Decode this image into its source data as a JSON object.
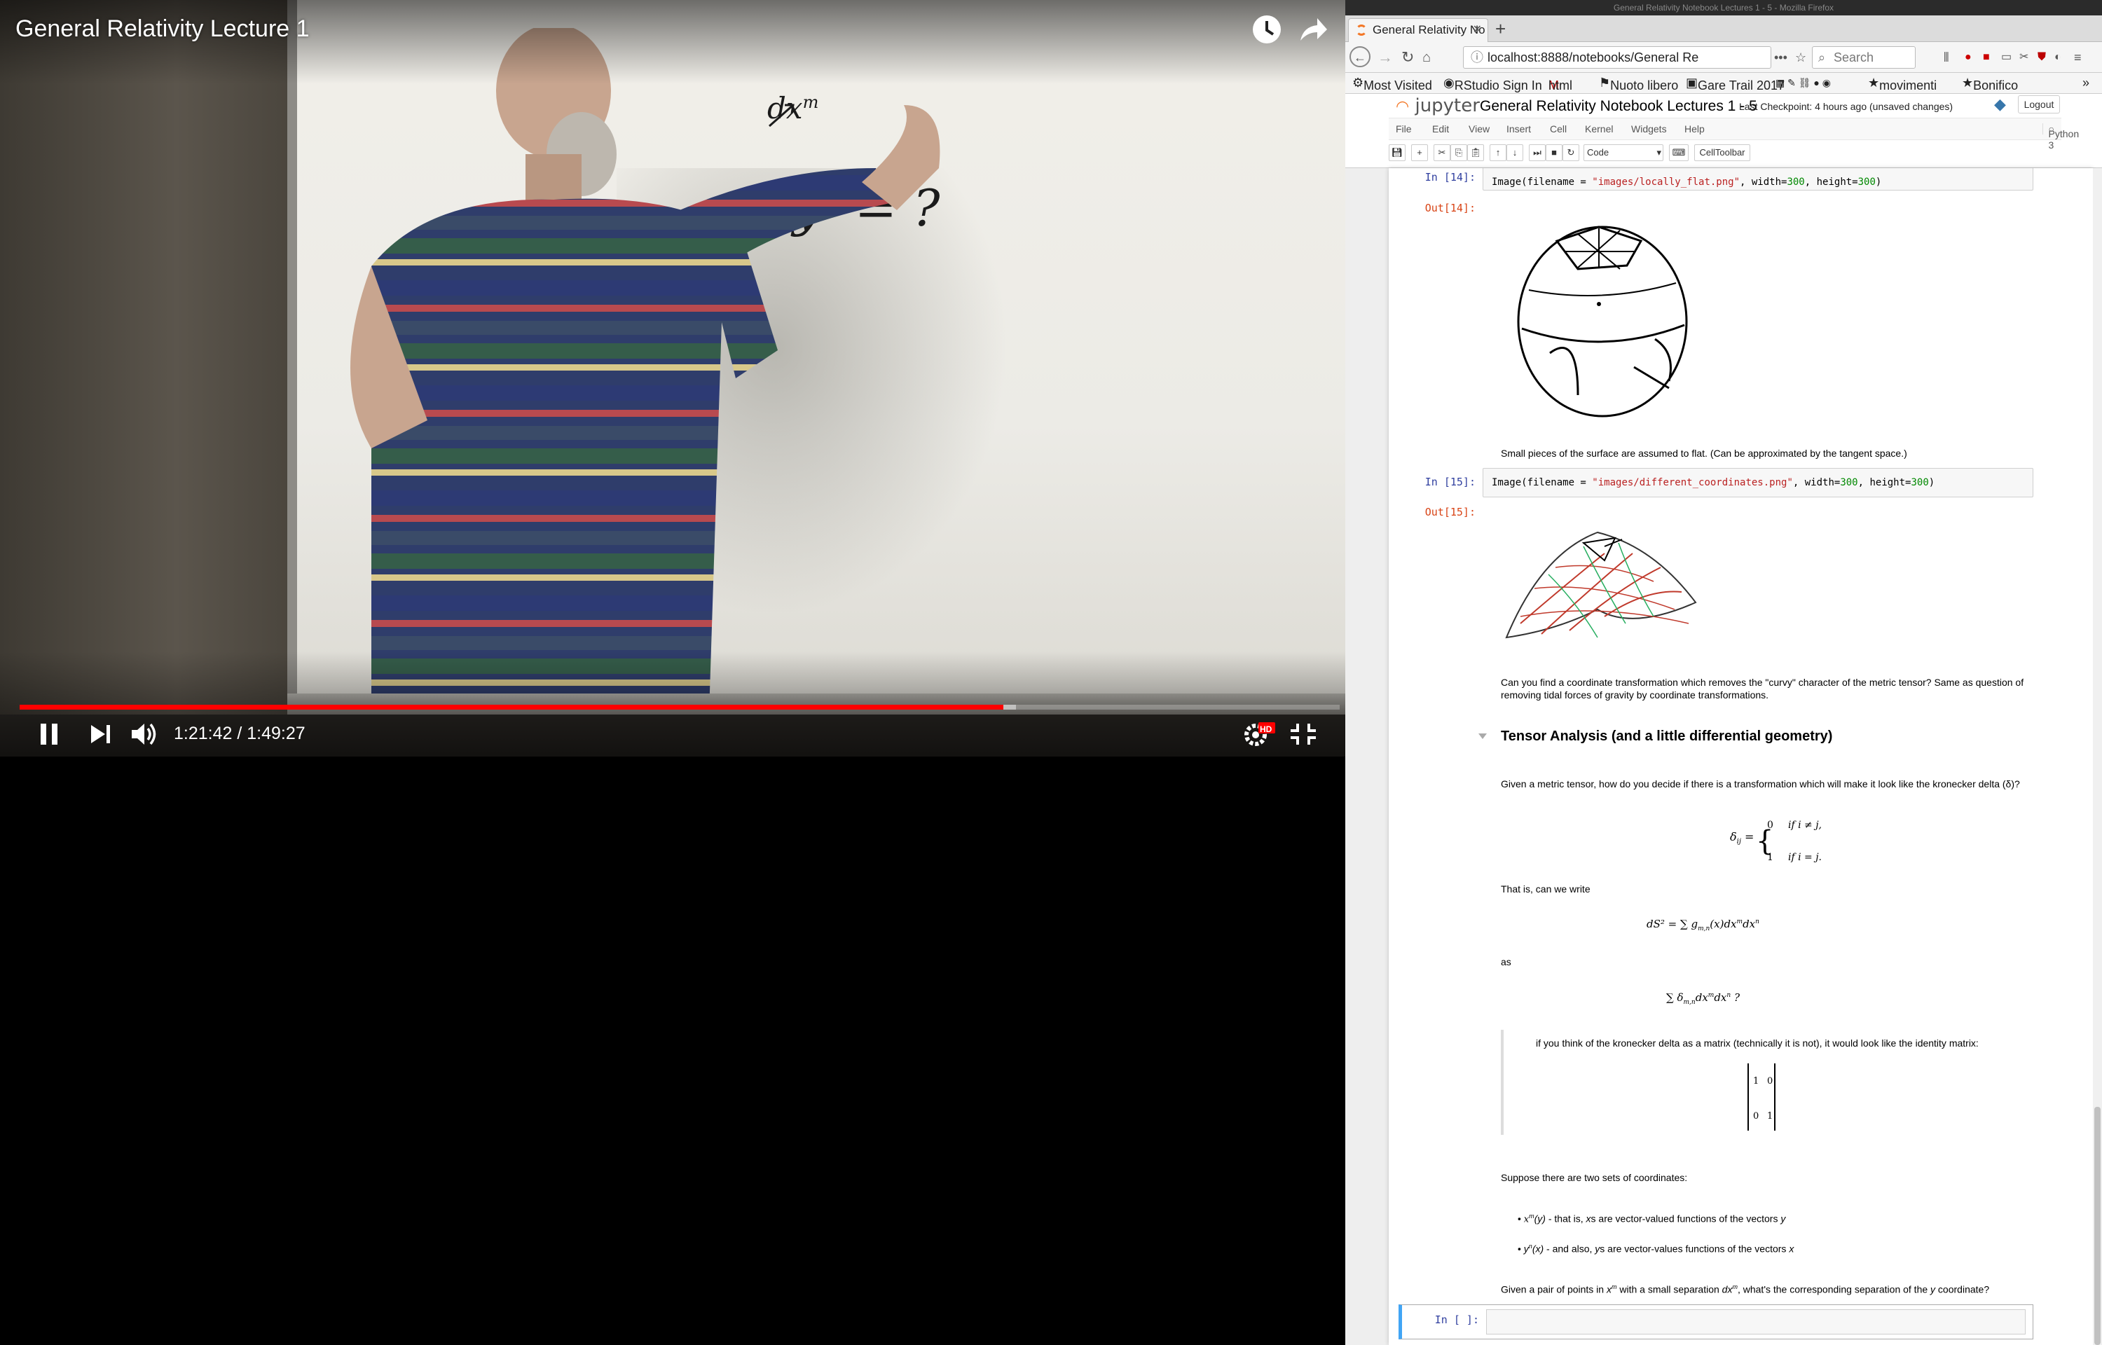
{
  "video": {
    "title": "General Relativity Lecture 1",
    "time": "1:21:42 / 1:49:27",
    "progress_played_fraction": 0.745,
    "progress_loaded_fraction": 0.755,
    "board_writing": [
      "dx",
      "m",
      "dy",
      "m",
      "= ?"
    ],
    "quality_badge": "HD",
    "icons": {
      "watch_later": "clock-icon",
      "share": "share-arrow-icon",
      "pause": "pause-icon",
      "next": "skip-next-icon",
      "volume": "volume-icon",
      "settings": "gear-icon",
      "fullscreen": "exit-fullscreen-icon"
    },
    "accent_color": "#ff0000"
  },
  "browser": {
    "window_title": "General Relativity Notebook Lectures 1 - 5 - Mozilla Firefox",
    "tab_title": "General Relativity No",
    "url": "localhost:8888/notebooks/General Re",
    "search_placeholder": "Search",
    "bookmarks": [
      "Most Visited",
      "RStudio Sign In",
      "html",
      "Nuoto libero",
      "Gare Trail 2017",
      "movimenti",
      "Bonifico"
    ]
  },
  "jupyter": {
    "logo": "jupyter",
    "notebook_title": "General Relativity Notebook Lectures 1 - 5",
    "checkpoint": "Last Checkpoint: 4 hours ago (unsaved changes)",
    "logout": "Logout",
    "menu": [
      "File",
      "Edit",
      "View",
      "Insert",
      "Cell",
      "Kernel",
      "Widgets",
      "Help"
    ],
    "kernel": "Python 3",
    "cell_type": "Code",
    "celltoolbar": "CellToolbar"
  },
  "cells": {
    "in14": "In [14]:",
    "code14_pre": "Image(filename = ",
    "code14_str": "\"images/locally_flat.png\"",
    "code14_mid": ", width=",
    "code14_w": "300",
    "code14_mid2": ", height=",
    "code14_h": "300",
    "code14_end": ")",
    "out14": "Out[14]:",
    "md1": "Small pieces of the surface are assumed to flat. (Can be approximated by the tangent space.)",
    "in15": "In [15]:",
    "code15_pre": "Image(filename = ",
    "code15_str": "\"images/different_coordinates.png\"",
    "code15_mid": ", width=",
    "code15_w": "300",
    "code15_mid2": ", height=",
    "code15_h": "300",
    "code15_end": ")",
    "out15": "Out[15]:",
    "md2_line1": "Can you find a coordinate transformation which removes the \"curvy\" character of the metric tensor? Same as question of",
    "md2_line2": "removing tidal forces of gravity by coordinate transformations.",
    "heading": "Tensor Analysis (and a little differential geometry)",
    "md3": "Given a metric tensor, how do you decide if there is a transformation which will make it look like the kronecker delta (δ)?",
    "delta_lhs": "δ",
    "delta_sub": "ij",
    "delta_eq": "=",
    "case1_val": "0",
    "case1_cond": "if i ≠ j,",
    "case2_val": "1",
    "case2_cond": "if i = j.",
    "md4": "That is, can we write",
    "eq1": "dS² = ∑ g",
    "eq1_sub": "m,n",
    "eq1_rest": "(x)dx",
    "eq1_sup1": "m",
    "eq1_rest2": "dx",
    "eq1_sup2": "n",
    "md5": "as",
    "eq2": "∑ δ",
    "eq2_sub": "m,n",
    "eq2_rest": "dx",
    "eq2_sup1": "m",
    "eq2_rest2": "dx",
    "eq2_sup2": "n",
    "eq2_q": " ?",
    "quote": "if you think of the kronecker delta as a matrix (technically it is not), it would look like the identity matrix:",
    "matrix": [
      [
        "1",
        "0"
      ],
      [
        "0",
        "1"
      ]
    ],
    "md6": "Suppose there are two sets of coordinates:",
    "bullet1_a": "x",
    "bullet1_sup": "m",
    "bullet1_b": "(y)",
    "bullet1_c": " - that is, ",
    "bullet1_d": "x",
    "bullet1_e": "s are vector-valued functions of the vectors ",
    "bullet1_f": "y",
    "bullet2_a": "y",
    "bullet2_sup": "n",
    "bullet2_b": "(x)",
    "bullet2_c": " - and also, ",
    "bullet2_d": "y",
    "bullet2_e": "s are vector-values functions of the vectors ",
    "bullet2_f": "x",
    "md7_a": "Given a pair of points in ",
    "md7_b": "x",
    "md7_sup1": "m",
    "md7_c": " with a small separation ",
    "md7_d": "dx",
    "md7_sup2": "m",
    "md7_e": ", what's the corresponding separation of the ",
    "md7_f": "y",
    "md7_g": " coordinate?",
    "in_empty": "In [ ]:"
  }
}
